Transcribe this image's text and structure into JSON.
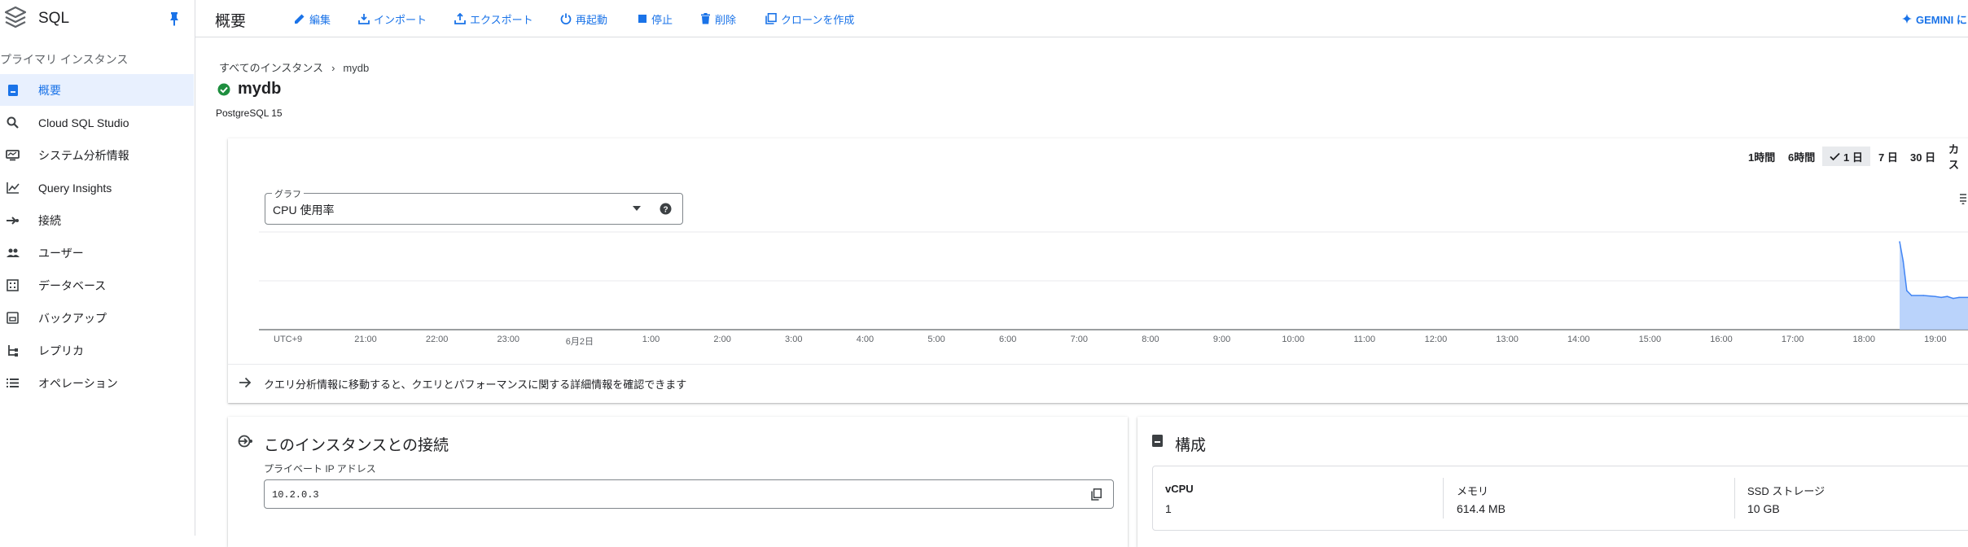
{
  "app": {
    "title": "SQL"
  },
  "sidebar": {
    "section": "プライマリ インスタンス",
    "items": [
      {
        "label": "概要",
        "icon": "overview-icon"
      },
      {
        "label": "Cloud SQL Studio",
        "icon": "search-icon"
      },
      {
        "label": "システム分析情報",
        "icon": "monitor-icon"
      },
      {
        "label": "Query Insights",
        "icon": "chart-icon"
      },
      {
        "label": "接続",
        "icon": "connection-icon"
      },
      {
        "label": "ユーザー",
        "icon": "users-icon"
      },
      {
        "label": "データベース",
        "icon": "database-icon"
      },
      {
        "label": "バックアップ",
        "icon": "backup-icon"
      },
      {
        "label": "レプリカ",
        "icon": "replica-icon"
      },
      {
        "label": "オペレーション",
        "icon": "list-icon"
      }
    ]
  },
  "header": {
    "title": "概要",
    "actions": {
      "edit": "編集",
      "import": "インポート",
      "export": "エクスポート",
      "restart": "再起動",
      "stop": "停止",
      "delete": "削除",
      "clone": "クローンを作成",
      "gemini": "GEMINI に"
    }
  },
  "breadcrumb": {
    "parent": "すべてのインスタンス",
    "sep": "›",
    "current": "mydb"
  },
  "instance": {
    "name": "mydb",
    "version": "PostgreSQL 15",
    "status": "running",
    "status_color": "#1e8e3e"
  },
  "chart": {
    "time_ranges": [
      "1時間",
      "6時間",
      "1 日",
      "7 日",
      "30 日",
      "カス"
    ],
    "selected_range": "1 日",
    "select_label": "グラフ",
    "select_value": "CPU 使用率",
    "tz_label": "UTC+9",
    "insight_link": "クエリ分析情報に移動すると、クエリとパフォーマンスに関する詳細情報を確認できます"
  },
  "chart_data": {
    "type": "area",
    "title": "CPU 使用率",
    "x_ticks": [
      "21:00",
      "22:00",
      "23:00",
      "6月2日",
      "1:00",
      "2:00",
      "3:00",
      "4:00",
      "5:00",
      "6:00",
      "7:00",
      "8:00",
      "9:00",
      "10:00",
      "11:00",
      "12:00",
      "13:00",
      "14:00",
      "15:00",
      "16:00",
      "17:00",
      "18:00",
      "19:00"
    ],
    "series": [
      {
        "x": [
          "18:30",
          "18:33",
          "18:36",
          "18:40",
          "18:50",
          "19:00",
          "19:05",
          "19:10",
          "19:15",
          "19:20"
        ],
        "y": [
          0.9,
          0.7,
          0.4,
          0.35,
          0.35,
          0.34,
          0.33,
          0.34,
          0.32,
          0.33
        ]
      }
    ],
    "ylim": [
      0,
      1
    ],
    "color": "#aecbfa",
    "line_color": "#4285f4",
    "grid": true
  },
  "connection": {
    "title": "このインスタンスとの接続",
    "field_label": "プライベート IP アドレス",
    "ip": "10.2.0.3"
  },
  "config": {
    "title": "構成",
    "specs": [
      {
        "label": "vCPU",
        "value": "1"
      },
      {
        "label": "メモリ",
        "value": "614.4 MB"
      },
      {
        "label": "SSD ストレージ",
        "value": "10 GB"
      }
    ]
  }
}
